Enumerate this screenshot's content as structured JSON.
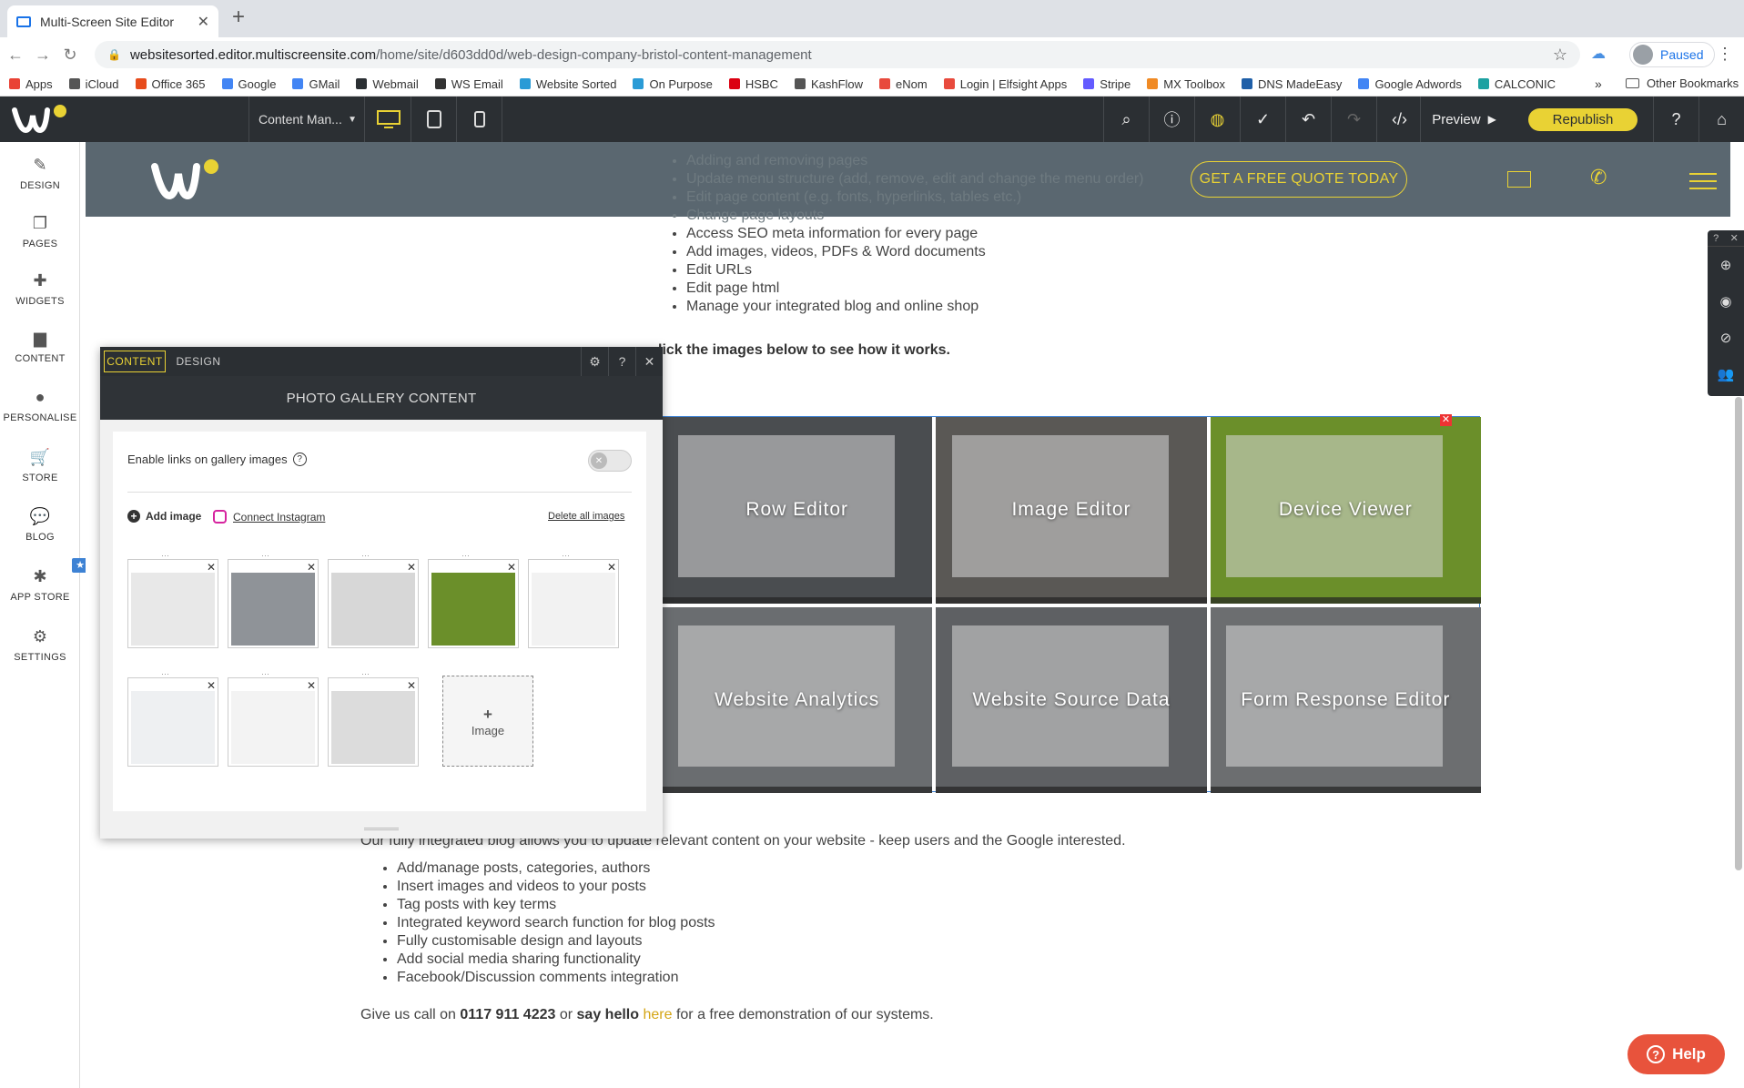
{
  "browser": {
    "tab_title": "Multi-Screen Site Editor",
    "url_host": "websitesorted.editor.multiscreensite.com",
    "url_path": "/home/site/d603dd0d/web-design-company-bristol-content-management",
    "profile_label": "Paused",
    "bookmarks": [
      {
        "label": "Apps",
        "color": "#e94235"
      },
      {
        "label": "iCloud",
        "color": "#555555"
      },
      {
        "label": "Office 365",
        "color": "#e74c1c"
      },
      {
        "label": "Google",
        "color": "#4285f4"
      },
      {
        "label": "GMail",
        "color": "#4285f4"
      },
      {
        "label": "Webmail",
        "color": "#2b2f33"
      },
      {
        "label": "WS Email",
        "color": "#333333"
      },
      {
        "label": "Website Sorted",
        "color": "#2a9bd6"
      },
      {
        "label": "On Purpose",
        "color": "#2a9bd6"
      },
      {
        "label": "HSBC",
        "color": "#db0011"
      },
      {
        "label": "KashFlow",
        "color": "#555555"
      },
      {
        "label": "eNom",
        "color": "#e84a3d"
      },
      {
        "label": "Login | Elfsight Apps",
        "color": "#e84a3d"
      },
      {
        "label": "Stripe",
        "color": "#635bff"
      },
      {
        "label": "MX Toolbox",
        "color": "#f08a24"
      },
      {
        "label": "DNS MadeEasy",
        "color": "#1f5fa8"
      },
      {
        "label": "Google Adwords",
        "color": "#4285f4"
      },
      {
        "label": "CALCONIC",
        "color": "#1da1a1"
      }
    ],
    "bookmarks_more": "»",
    "other_bookmarks": "Other Bookmarks"
  },
  "toolbar": {
    "page_selector": "Content Man...",
    "preview_label": "Preview",
    "republish_label": "Republish"
  },
  "sidebar": {
    "items": [
      {
        "label": "DESIGN",
        "icon": "✎"
      },
      {
        "label": "PAGES",
        "icon": "❐"
      },
      {
        "label": "WIDGETS",
        "icon": "✚"
      },
      {
        "label": "CONTENT",
        "icon": "▆"
      },
      {
        "label": "PERSONALISE",
        "icon": "●"
      },
      {
        "label": "STORE",
        "icon": "🛒"
      },
      {
        "label": "BLOG",
        "icon": "💬"
      },
      {
        "label": "APP STORE",
        "icon": "✱"
      },
      {
        "label": "SETTINGS",
        "icon": "⚙"
      }
    ]
  },
  "site": {
    "quote_button": "GET A FREE QUOTE TODAY",
    "top_list": [
      "Adding and removing pages",
      "Update menu structure (add, remove, edit and change the menu order)",
      "Edit page content (e.g. fonts, hyperlinks, tables etc.)",
      "Change page layouts",
      "Access SEO meta information for every page",
      "Add images, videos, PDFs & Word documents",
      "Edit URLs",
      "Edit page html",
      "Manage your integrated blog and online shop"
    ],
    "click_line": "lick the images below to see how it works.",
    "gallery": [
      {
        "caption": "Row Editor",
        "color": "#4a4d50"
      },
      {
        "caption": "Image Editor",
        "color": "#5a5855"
      },
      {
        "caption": "Device Viewer",
        "color": "#6b8f2a"
      },
      {
        "caption": "Website Analytics",
        "color": "#6a6d70"
      },
      {
        "caption": "Website Source Data",
        "color": "#5e6063"
      },
      {
        "caption": "Form Response Editor",
        "color": "#6c6e70"
      }
    ],
    "blog_paragraph": "Our fully integrated blog allows you to update relevant content on your website - keep users and the Google interested.",
    "bottom_list": [
      "Add/manage posts, categories, authors",
      "Insert images and videos to your posts",
      "Tag posts with key terms",
      "Integrated keyword search function for blog posts",
      "Fully customisable design and layouts",
      "Add social media sharing functionality",
      "Facebook/Discussion comments integration"
    ],
    "call_prefix": "Give us call on ",
    "phone": "0117 911 4223",
    "call_mid": " or ",
    "say_hello": "say hello",
    "here_link": "here",
    "call_suffix": " for a free demonstration of our systems.",
    "help_label": "Help"
  },
  "panel": {
    "tab_content": "CONTENT",
    "tab_design": "DESIGN",
    "title": "PHOTO GALLERY CONTENT",
    "toggle_label": "Enable links on gallery images",
    "add_image": "Add image",
    "connect_instagram": "Connect Instagram",
    "delete_all": "Delete all images",
    "add_tile_label": "Image",
    "thumbs": [
      {
        "color": "#e8e8e8"
      },
      {
        "color": "#8f9398"
      },
      {
        "color": "#d7d7d7"
      },
      {
        "color": "#6b8f2a"
      },
      {
        "color": "#f2f2f2"
      },
      {
        "color": "#eef0f2"
      },
      {
        "color": "#f3f3f3"
      },
      {
        "color": "#dcdcdc"
      }
    ]
  },
  "colors": {
    "accent": "#e9d234",
    "editor_dark": "#2b2f33",
    "site_header": "#5a6770",
    "selection_blue": "#3d82d4"
  }
}
